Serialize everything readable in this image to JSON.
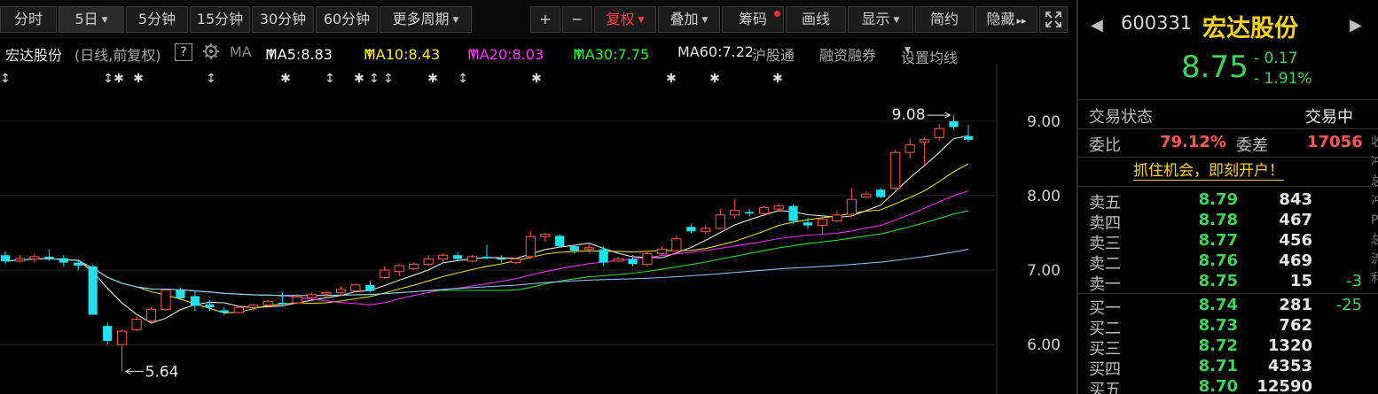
{
  "toolbar": {
    "periods": [
      "分时",
      "5日",
      "5分钟",
      "15分钟",
      "30分钟",
      "60分钟",
      "更多周期"
    ],
    "controls": [
      "+",
      "−",
      "复权",
      "叠加",
      "筹码",
      "画线",
      "显示",
      "简约",
      "隐藏"
    ]
  },
  "legend": {
    "stock_name": "宏达股份",
    "mode": "(日线,前复权)",
    "help": "?",
    "ma_label": "MA",
    "ma5": "MA5:8.83",
    "ma10": "MA10:8.43",
    "ma20": "MA20:8.03",
    "ma30": "MA30:7.75",
    "ma60": "MA60:7.22",
    "hgt": "沪股通",
    "rzrq": "融资融券",
    "settings": "设置均线",
    "colors": {
      "ma5": "#ffffff",
      "ma10": "#ffee33",
      "ma20": "#ff33ff",
      "ma30": "#33ee33",
      "ma60": "#99ccff"
    }
  },
  "chart_data": {
    "type": "candlestick",
    "y_ticks": [
      "9.00",
      "8.00",
      "7.00",
      "6.00"
    ],
    "ylim": [
      5.55,
      9.2
    ],
    "annotations": [
      {
        "text": "9.08",
        "kind": "high"
      },
      {
        "text": "5.64",
        "kind": "low"
      }
    ],
    "up_color": "#ff5a4a",
    "down_color": "#22e0ee",
    "candles": [
      [
        7.2,
        7.25,
        7.08,
        7.12
      ],
      [
        7.12,
        7.2,
        7.1,
        7.15
      ],
      [
        7.15,
        7.22,
        7.1,
        7.18
      ],
      [
        7.18,
        7.28,
        7.12,
        7.16
      ],
      [
        7.16,
        7.2,
        7.05,
        7.1
      ],
      [
        7.1,
        7.14,
        7.0,
        7.06
      ],
      [
        7.05,
        7.07,
        6.4,
        6.4
      ],
      [
        6.25,
        6.3,
        6.0,
        6.05
      ],
      [
        6.0,
        6.2,
        5.64,
        6.18
      ],
      [
        6.2,
        6.38,
        6.18,
        6.34
      ],
      [
        6.32,
        6.5,
        6.3,
        6.47
      ],
      [
        6.47,
        6.75,
        6.45,
        6.73
      ],
      [
        6.73,
        6.76,
        6.6,
        6.62
      ],
      [
        6.65,
        6.72,
        6.45,
        6.52
      ],
      [
        6.54,
        6.6,
        6.45,
        6.5
      ],
      [
        6.46,
        6.5,
        6.4,
        6.43
      ],
      [
        6.43,
        6.52,
        6.42,
        6.5
      ],
      [
        6.5,
        6.55,
        6.45,
        6.53
      ],
      [
        6.53,
        6.6,
        6.5,
        6.58
      ],
      [
        6.56,
        6.7,
        6.52,
        6.55
      ],
      [
        6.56,
        6.68,
        6.55,
        6.64
      ],
      [
        6.63,
        6.7,
        6.6,
        6.67
      ],
      [
        6.68,
        6.72,
        6.62,
        6.7
      ],
      [
        6.7,
        6.78,
        6.66,
        6.74
      ],
      [
        6.72,
        6.82,
        6.7,
        6.8
      ],
      [
        6.8,
        6.86,
        6.7,
        6.72
      ],
      [
        6.9,
        7.05,
        6.88,
        7.0
      ],
      [
        6.98,
        7.08,
        6.92,
        7.06
      ],
      [
        7.02,
        7.1,
        7.0,
        7.08
      ],
      [
        7.08,
        7.2,
        7.06,
        7.15
      ],
      [
        7.15,
        7.22,
        7.1,
        7.2
      ],
      [
        7.2,
        7.24,
        7.12,
        7.15
      ],
      [
        7.12,
        7.2,
        7.1,
        7.18
      ],
      [
        7.18,
        7.34,
        7.14,
        7.16
      ],
      [
        7.16,
        7.2,
        7.1,
        7.14
      ],
      [
        7.1,
        7.17,
        7.08,
        7.15
      ],
      [
        7.18,
        7.52,
        7.15,
        7.45
      ],
      [
        7.45,
        7.5,
        7.38,
        7.48
      ],
      [
        7.46,
        7.48,
        7.3,
        7.32
      ],
      [
        7.32,
        7.34,
        7.22,
        7.26
      ],
      [
        7.28,
        7.36,
        7.24,
        7.3
      ],
      [
        7.28,
        7.32,
        7.05,
        7.1
      ],
      [
        7.12,
        7.18,
        7.1,
        7.15
      ],
      [
        7.15,
        7.2,
        7.05,
        7.08
      ],
      [
        7.08,
        7.24,
        7.05,
        7.22
      ],
      [
        7.22,
        7.32,
        7.2,
        7.28
      ],
      [
        7.26,
        7.46,
        7.24,
        7.42
      ],
      [
        7.58,
        7.62,
        7.5,
        7.52
      ],
      [
        7.52,
        7.6,
        7.48,
        7.56
      ],
      [
        7.56,
        7.82,
        7.55,
        7.74
      ],
      [
        7.74,
        7.95,
        7.7,
        7.8
      ],
      [
        7.78,
        7.82,
        7.72,
        7.76
      ],
      [
        7.76,
        7.86,
        7.72,
        7.84
      ],
      [
        7.82,
        7.9,
        7.78,
        7.86
      ],
      [
        7.86,
        7.88,
        7.62,
        7.66
      ],
      [
        7.64,
        7.7,
        7.55,
        7.6
      ],
      [
        7.6,
        7.74,
        7.48,
        7.68
      ],
      [
        7.66,
        7.8,
        7.64,
        7.74
      ],
      [
        7.75,
        8.1,
        7.72,
        7.95
      ],
      [
        7.98,
        8.06,
        7.96,
        8.02
      ],
      [
        8.08,
        8.1,
        7.96,
        7.98
      ],
      [
        8.1,
        8.62,
        8.08,
        8.58
      ],
      [
        8.58,
        8.76,
        8.5,
        8.68
      ],
      [
        8.72,
        8.78,
        8.4,
        8.75
      ],
      [
        8.78,
        8.96,
        8.74,
        8.9
      ],
      [
        9.0,
        9.08,
        8.88,
        8.92
      ],
      [
        8.8,
        8.95,
        8.72,
        8.75
      ]
    ]
  },
  "panel": {
    "code": "600331",
    "name": "宏达股份",
    "price": "8.75",
    "change": "- 0.17",
    "change_pct": "- 1.91%",
    "status_label": "交易状态",
    "status_value": "交易中",
    "webi_label": "委比",
    "webi_value": "79.12%",
    "weicha_label": "委差",
    "weicha_value": "17056",
    "promo": "抓住机会，即刻开户！",
    "asks": [
      {
        "label": "卖五",
        "price": "8.79",
        "vol": "843",
        "chg": ""
      },
      {
        "label": "卖四",
        "price": "8.78",
        "vol": "467",
        "chg": ""
      },
      {
        "label": "卖三",
        "price": "8.77",
        "vol": "456",
        "chg": ""
      },
      {
        "label": "卖二",
        "price": "8.76",
        "vol": "469",
        "chg": ""
      },
      {
        "label": "卖一",
        "price": "8.75",
        "vol": "15",
        "chg": "-3"
      }
    ],
    "bids": [
      {
        "label": "买一",
        "price": "8.74",
        "vol": "281",
        "chg": "-25"
      },
      {
        "label": "买二",
        "price": "8.73",
        "vol": "762",
        "chg": ""
      },
      {
        "label": "买三",
        "price": "8.72",
        "vol": "1320",
        "chg": ""
      },
      {
        "label": "买四",
        "price": "8.71",
        "vol": "4353",
        "chg": ""
      },
      {
        "label": "买五",
        "price": "8.70",
        "vol": "12590",
        "chg": ""
      }
    ]
  }
}
